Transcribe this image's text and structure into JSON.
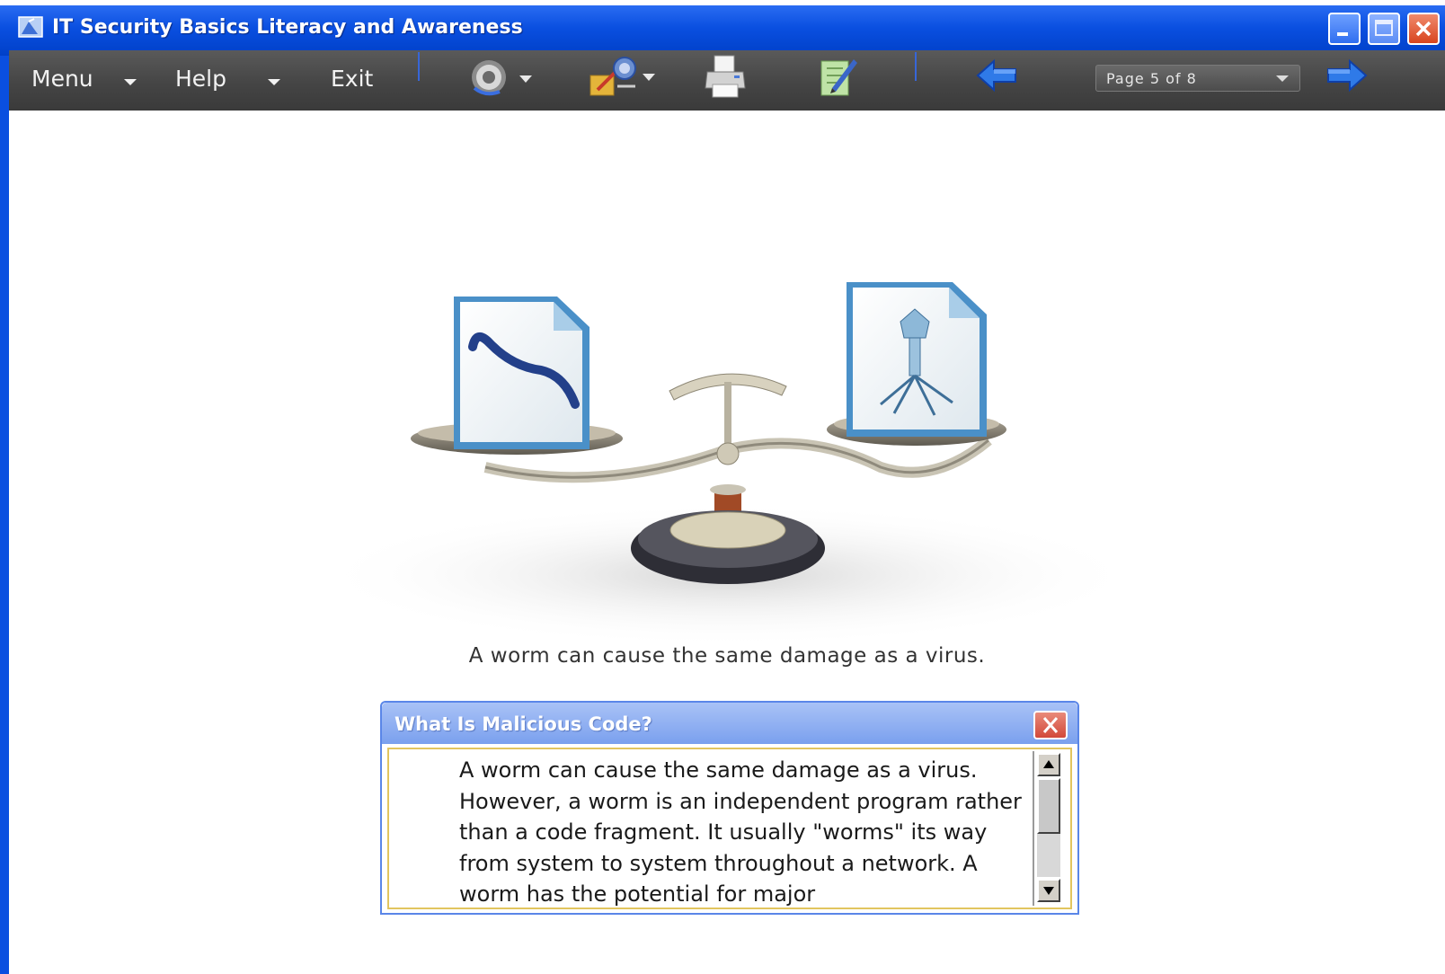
{
  "window": {
    "title": "IT Security Basics Literacy and Awareness"
  },
  "toolbar": {
    "menu_label": "Menu",
    "help_label": "Help",
    "exit_label": "Exit",
    "page_selector": "Page 5 of 8",
    "icons": [
      "audio-icon",
      "glossary-icon",
      "print-icon",
      "notes-icon",
      "back-arrow-icon",
      "forward-arrow-icon"
    ]
  },
  "content": {
    "caption": "A worm can cause the same damage as a virus."
  },
  "popup": {
    "title": "What Is Malicious Code?",
    "text": "A worm can cause the same damage as a virus. However, a worm is an independent program rather than a code fragment. It usually \"worms\" its way from system to system throughout a network. A worm has the potential for major"
  },
  "colors": {
    "titlebar": "#0a4fe0",
    "toolbar": "#454545",
    "popup_header": "#7aa0ee",
    "accent_arrow": "#2f7ae8"
  }
}
